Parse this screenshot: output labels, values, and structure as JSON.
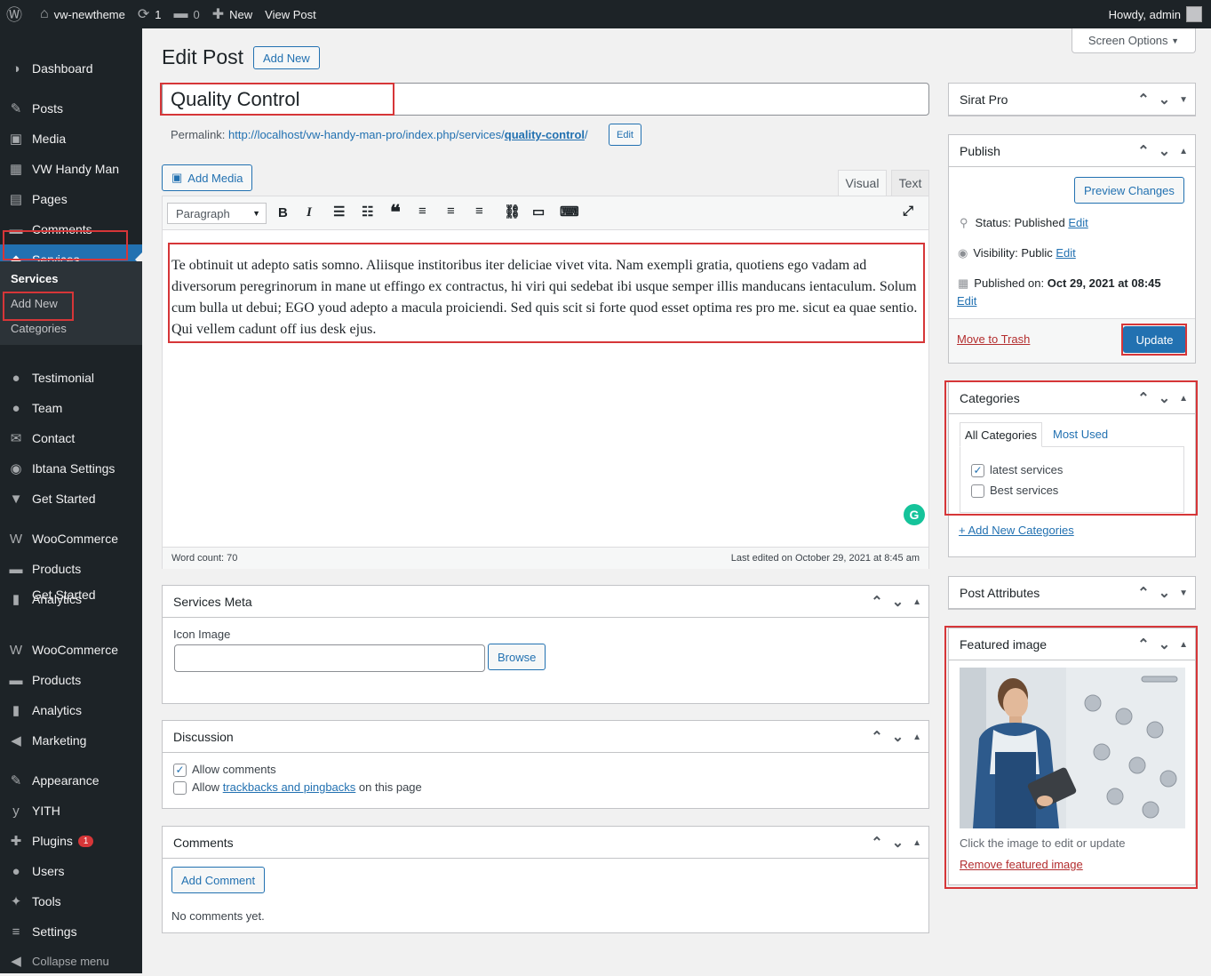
{
  "adminbar": {
    "site": "vw-newtheme",
    "updates": "1",
    "comments": "0",
    "new": "New",
    "view_post": "View Post",
    "howdy": "Howdy, admin"
  },
  "menu": {
    "items": [
      {
        "label": "Dashboard",
        "icon": "dashboard-icon",
        "glyph": "◑"
      },
      {
        "label": "Posts",
        "icon": "pin-icon",
        "glyph": "✎"
      },
      {
        "label": "Media",
        "icon": "media-icon",
        "glyph": "▣"
      },
      {
        "label": "VW Handy Man",
        "icon": "calendar-icon",
        "glyph": "▦"
      },
      {
        "label": "Pages",
        "icon": "pages-icon",
        "glyph": "▤"
      },
      {
        "label": "Comments",
        "icon": "comment-icon",
        "glyph": "▬"
      },
      {
        "label": "Services",
        "icon": "tag-icon",
        "glyph": "◆"
      },
      {
        "label": "Testimonial",
        "icon": "user-icon",
        "glyph": "●"
      },
      {
        "label": "Team",
        "icon": "user-icon",
        "glyph": "●"
      },
      {
        "label": "Contact",
        "icon": "mail-icon",
        "glyph": "✉"
      },
      {
        "label": "Ibtana Settings",
        "icon": "settings-circle-icon",
        "glyph": "◉"
      },
      {
        "label": "Get Started",
        "icon": "chevron-down-icon",
        "glyph": "▼"
      },
      {
        "label": "WooCommerce",
        "icon": "woo-icon",
        "glyph": "W"
      },
      {
        "label": "Products",
        "icon": "archive-icon",
        "glyph": "▬"
      },
      {
        "label": "Analytics",
        "icon": "chart-icon",
        "glyph": "▮"
      },
      {
        "label": "WooCommerce",
        "icon": "woo-icon",
        "glyph": "W"
      },
      {
        "label": "Products",
        "icon": "archive-icon",
        "glyph": "▬"
      },
      {
        "label": "Analytics",
        "icon": "chart-icon",
        "glyph": "▮"
      },
      {
        "label": "Marketing",
        "icon": "megaphone-icon",
        "glyph": "◀"
      },
      {
        "label": "Appearance",
        "icon": "brush-icon",
        "glyph": "✎"
      },
      {
        "label": "YITH",
        "icon": "yith-icon",
        "glyph": "y"
      },
      {
        "label": "Plugins",
        "icon": "plugin-icon",
        "glyph": "✚"
      },
      {
        "label": "Users",
        "icon": "users-icon",
        "glyph": "●"
      },
      {
        "label": "Tools",
        "icon": "wrench-icon",
        "glyph": "✦"
      },
      {
        "label": "Settings",
        "icon": "sliders-icon",
        "glyph": "≡"
      },
      {
        "label": "Collapse menu",
        "icon": "collapse-icon",
        "glyph": "◀"
      }
    ],
    "overlap_label": "Get Started",
    "plugins_badge": "1",
    "services_sub": [
      "Services",
      "Add New",
      "Categories"
    ]
  },
  "screen_options": "Screen Options",
  "page_title": "Edit Post",
  "add_new": "Add New",
  "post_title": "Quality Control",
  "permalink": {
    "label": "Permalink:",
    "url_prefix": "http://localhost/vw-handy-man-pro/index.php/services/",
    "slug": "quality-control",
    "url_suffix": "/",
    "edit": "Edit"
  },
  "editor": {
    "add_media": "Add Media",
    "tab_visual": "Visual",
    "tab_text": "Text",
    "format": "Paragraph",
    "content": "Te obtinuit ut adepto satis somno. Aliisque institoribus iter deliciae vivet vita. Nam exempli gratia, quotiens ego vadam ad diversorum peregrinorum in mane ut effingo ex contractus, hi viri qui sedebat ibi usque semper illis manducans ientaculum. Solum cum bulla ut debui; EGO youd adepto a macula proiciendi. Sed quis scit si forte quod esset optima res pro me. sicut ea quae sentio. Qui vellem cadunt off ius desk ejus.",
    "word_count": "Word count: 70",
    "last_edited": "Last edited on October 29, 2021 at 8:45 am"
  },
  "services_meta": {
    "title": "Services Meta",
    "icon_label": "Icon Image",
    "browse": "Browse"
  },
  "discussion": {
    "title": "Discussion",
    "allow_comments": "Allow comments",
    "allow": "Allow",
    "trackbacks": "trackbacks and pingbacks",
    "on_this_page": "on this page"
  },
  "comments": {
    "title": "Comments",
    "add_comment": "Add Comment",
    "none": "No comments yet."
  },
  "sirat": {
    "title": "Sirat Pro"
  },
  "publish": {
    "title": "Publish",
    "preview": "Preview Changes",
    "status_label": "Status:",
    "status": "Published",
    "visibility_label": "Visibility:",
    "visibility": "Public",
    "published_label": "Published on:",
    "published": "Oct 29, 2021 at 08:45",
    "edit": "Edit",
    "trash": "Move to Trash",
    "update": "Update"
  },
  "categories": {
    "title": "Categories",
    "tab_all": "All Categories",
    "tab_most": "Most Used",
    "items": [
      "latest services",
      "Best services"
    ],
    "add_new": "+ Add New Categories"
  },
  "post_attributes": {
    "title": "Post Attributes"
  },
  "featured": {
    "title": "Featured image",
    "hint": "Click the image to edit or update",
    "remove": "Remove featured image"
  }
}
